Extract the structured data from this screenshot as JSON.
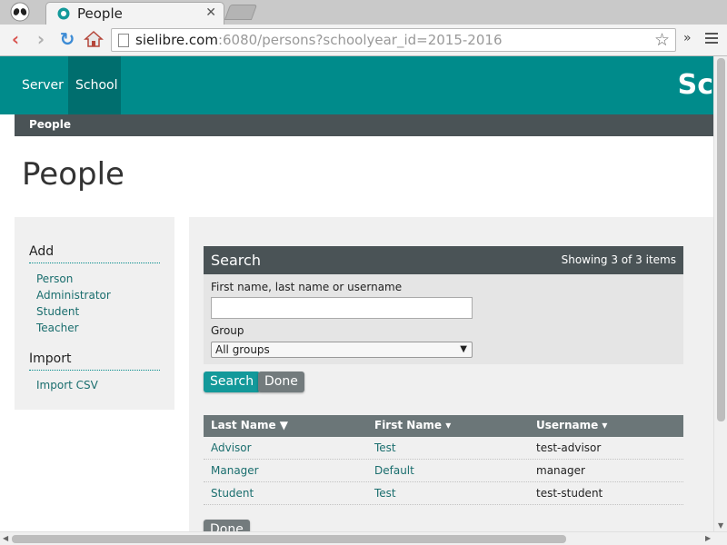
{
  "browser": {
    "tab_title": "People",
    "tab_close": "✕",
    "url_host": "sielibre.com",
    "url_rest": ":6080/persons?schoolyear_id=2015-2016",
    "overflow_glyph": "»",
    "star_glyph": "☆"
  },
  "nav": {
    "items": [
      "Server",
      "School"
    ],
    "active": "School",
    "brand": "Sc"
  },
  "breadcrumb": "People",
  "page_title": "People",
  "sidebar": {
    "add_heading": "Add",
    "add_links": [
      "Person",
      "Administrator",
      "Student",
      "Teacher"
    ],
    "import_heading": "Import",
    "import_links": [
      "Import CSV"
    ]
  },
  "search": {
    "title": "Search",
    "count": "Showing 3 of 3 items",
    "name_label": "First name, last name or username",
    "name_value": "",
    "group_label": "Group",
    "group_selected": "All groups",
    "search_button": "Search",
    "done_button": "Done"
  },
  "table": {
    "headers": [
      "Last Name ▼",
      "First Name ▾",
      "Username ▾"
    ],
    "rows": [
      {
        "last": "Advisor",
        "first": "Test",
        "username": "test-advisor"
      },
      {
        "last": "Manager",
        "first": "Default",
        "username": "manager"
      },
      {
        "last": "Student",
        "first": "Test",
        "username": "test-student"
      }
    ]
  },
  "footer": {
    "done_button": "Done"
  },
  "colors": {
    "accent": "#008b8b",
    "accent_dark": "#006e6e",
    "header_gray": "#4a5356",
    "panel": "#f0f0f0"
  },
  "icons": [
    "alien-logo-icon",
    "favicon-icon",
    "close-icon",
    "back-icon",
    "forward-icon",
    "reload-icon",
    "home-icon",
    "page-icon",
    "star-icon",
    "menu-icon",
    "dropdown-arrow-icon"
  ]
}
